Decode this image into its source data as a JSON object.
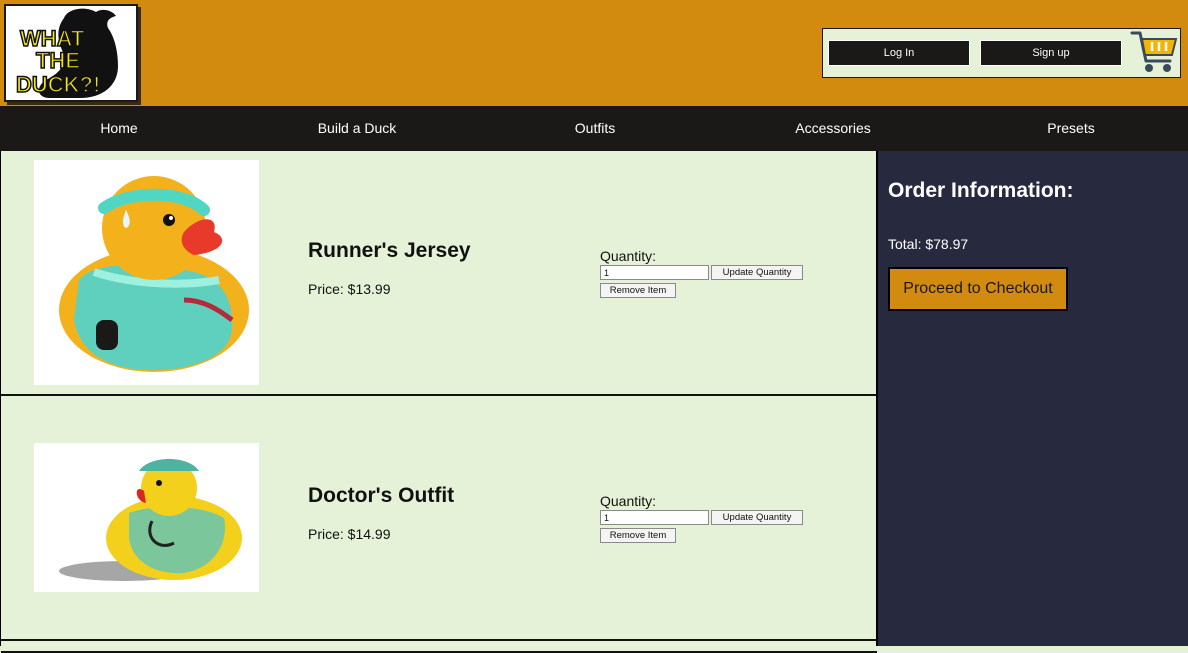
{
  "brand": {
    "logo_text": [
      "WHAT",
      "THE",
      "DUCK?!"
    ],
    "accent_color": "#d28b0f",
    "dark_color": "#1b1818",
    "panel_color": "#272a3f",
    "bg_color": "#e5f2d8"
  },
  "auth": {
    "login_label": "Log In",
    "signup_label": "Sign up",
    "cart_icon": "shopping-cart-icon"
  },
  "nav": {
    "items": [
      {
        "label": "Home"
      },
      {
        "label": "Build a Duck"
      },
      {
        "label": "Outfits"
      },
      {
        "label": "Accessories"
      },
      {
        "label": "Presets"
      }
    ]
  },
  "cart": {
    "items": [
      {
        "name": "Runner's Jersey",
        "price": "Price: $13.99",
        "quantity_label": "Quantity:",
        "quantity_value": "1",
        "update_label": "Update Quantity",
        "remove_label": "Remove Item",
        "image_icon": "runner-duck-image"
      },
      {
        "name": "Doctor's Outfit",
        "price": "Price: $14.99",
        "quantity_label": "Quantity:",
        "quantity_value": "1",
        "update_label": "Update Quantity",
        "remove_label": "Remove Item",
        "image_icon": "doctor-duck-image"
      }
    ]
  },
  "order": {
    "title": "Order Information:",
    "total": "Total: $78.97",
    "checkout_label": "Proceed to Checkout"
  }
}
